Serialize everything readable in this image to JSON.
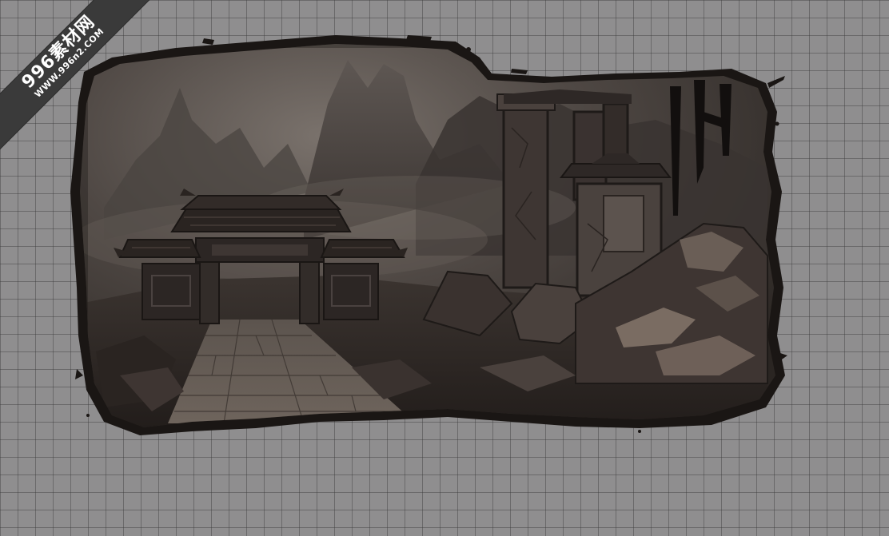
{
  "watermark": {
    "title": "996素材网",
    "url": "WWW.996n2.COM"
  },
  "scene": {
    "subject": "ruined-temple-gate-illustration",
    "colors": {
      "background": "#8f8e8f",
      "grid_line": "#5e5e5e",
      "sky": "#5c5652",
      "ink": "#1a1614",
      "stone": "#6a605a"
    }
  }
}
